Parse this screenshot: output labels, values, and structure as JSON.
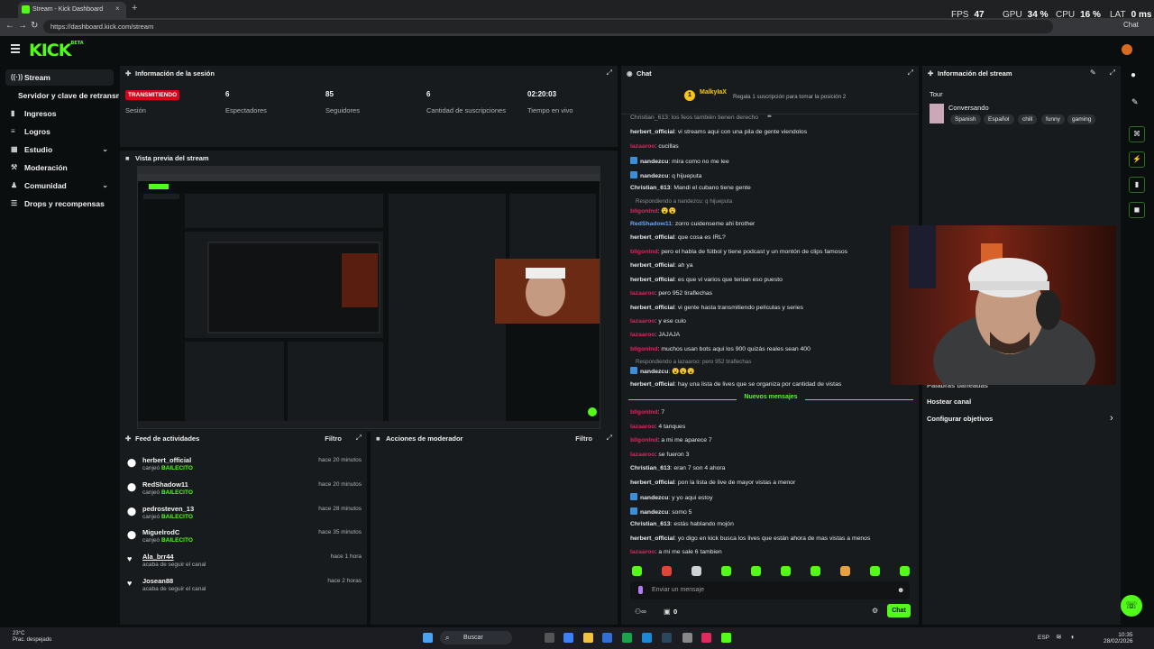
{
  "browser": {
    "tab_title": "Stream - Kick Dashboard",
    "tab_close": "×",
    "new_tab": "+",
    "url": "https://dashboard.kick.com/stream",
    "chat_pill": "Chat",
    "perf": [
      {
        "label": "FPS",
        "value": "47"
      },
      {
        "label": "GPU",
        "value": "34 %"
      },
      {
        "label": "CPU",
        "value": "16 %"
      },
      {
        "label": "LAT",
        "value": "0 ms"
      }
    ]
  },
  "app": {
    "logo": "KICK",
    "logo_sup": "BETA"
  },
  "sidebar": {
    "items": [
      {
        "icon": "((·))",
        "label": "Stream",
        "active": true
      },
      {
        "icon": "",
        "label": "Servidor y clave de retransmisión"
      },
      {
        "icon": "▮",
        "label": "Ingresos"
      },
      {
        "icon": "≡",
        "label": "Logros"
      },
      {
        "icon": "▦",
        "label": "Estudio",
        "chevron": "⌄"
      },
      {
        "icon": "⚒",
        "label": "Moderación"
      },
      {
        "icon": "♟",
        "label": "Comunidad",
        "chevron": "⌄"
      },
      {
        "icon": "☰",
        "label": "Drops y recompensas"
      }
    ]
  },
  "session": {
    "title": "Información de la sesión",
    "live_badge": "TRANSMITIENDO",
    "session_label": "Sesión",
    "stats": [
      {
        "value": "6",
        "label": "Espectadores"
      },
      {
        "value": "85",
        "label": "Seguidores"
      },
      {
        "value": "6",
        "label": "Cantidad de suscripciones"
      },
      {
        "value": "02:20:03",
        "label": "Tiempo en vivo"
      }
    ]
  },
  "preview": {
    "title": "Vista previa del stream"
  },
  "activity": {
    "title": "Feed de actividades",
    "filter": "Filtro",
    "items": [
      {
        "name": "herbert_official",
        "sub": "canjeó ",
        "reward": "BAILECITO",
        "time": "hace 20 minutos",
        "icon": "⬤"
      },
      {
        "name": "RedShadow11",
        "sub": "canjeó ",
        "reward": "BAILECITO",
        "time": "hace 20 minutos",
        "icon": "⬤"
      },
      {
        "name": "pedrosteven_13",
        "sub": "canjeó ",
        "reward": "BAILECITO",
        "time": "hace 28 minutos",
        "icon": "⬤"
      },
      {
        "name": "MiguelrodC",
        "sub": "canjeó ",
        "reward": "BAILECITO",
        "time": "hace 35 minutos",
        "icon": "⬤"
      },
      {
        "name": "Ala_brr44",
        "sub": "acaba de seguir el canal",
        "reward": "",
        "time": "hace 1 hora",
        "icon": "♥"
      },
      {
        "name": "Josean88",
        "sub": "acaba de seguir el canal",
        "reward": "",
        "time": "hace 2 horas",
        "icon": "♥"
      }
    ]
  },
  "mod_actions": {
    "title": "Acciones de moderador",
    "filter": "Filtro"
  },
  "chat": {
    "title": "Chat",
    "top_user": "MalkyIaX",
    "top_rank": "1",
    "gift_text": "Regala 1 suscripción para tomar la posición 2",
    "first_line": "Christian_613: los feos también tienen derecho",
    "new_messages": "Nuevos mensajes",
    "input_placeholder": "Enviar un mensaje",
    "send": "Chat",
    "points": "0",
    "messages": [
      {
        "user": "herbert_official",
        "color": "#e6e8ea",
        "text": "vi streams aqui con una pila de gente viendolos",
        "badge": false
      },
      {
        "user": "lazaaroo",
        "color": "#e0245e",
        "text": "cucillas",
        "badge": false
      },
      {
        "user": "nandezcu",
        "color": "#e6e8ea",
        "text": "mira como no me lee",
        "badge": true
      },
      {
        "user": "nandezcu",
        "color": "#e6e8ea",
        "text": "q hijueputa",
        "badge": true
      },
      {
        "user": "Christian_613",
        "color": "#e6e8ea",
        "text": "Mandi el cubano tiene gente",
        "badge": false
      },
      {
        "user": "bllgonlnd",
        "color": "#e0245e",
        "text": "😮😮",
        "badge": false
      },
      {
        "user": "RedShadow11",
        "color": "#69a5ff",
        "text": "zorro cuidensemе ahi brother",
        "badge": false
      },
      {
        "user": "herbert_official",
        "color": "#e6e8ea",
        "text": "que cosa es IRL?",
        "badge": false
      },
      {
        "user": "bllgonlnd",
        "color": "#e0245e",
        "text": "pero el habla de fútbol y tiene podcast y un montón de clips famosos",
        "badge": false
      },
      {
        "user": "herbert_official",
        "color": "#e6e8ea",
        "text": "ah ya",
        "badge": false
      },
      {
        "user": "herbert_official",
        "color": "#e6e8ea",
        "text": "es que vi varios que tenian eso puesto",
        "badge": false
      },
      {
        "user": "lazaaroo",
        "color": "#e0245e",
        "text": "pero 952 tiraflechas",
        "badge": false
      },
      {
        "user": "herbert_official",
        "color": "#e6e8ea",
        "text": "vi gente hasta transmitiendo películas y series",
        "badge": false
      },
      {
        "user": "lazaaroo",
        "color": "#e0245e",
        "text": "y ese culo",
        "badge": false
      },
      {
        "user": "lazaaroo",
        "color": "#e0245e",
        "text": "JAJAJA",
        "badge": false
      },
      {
        "user": "bllgonlnd",
        "color": "#e0245e",
        "text": "muchos usan bots aqui los 900 quizás reales sean 400",
        "badge": false
      },
      {
        "user": "nandezcu",
        "color": "#e6e8ea",
        "text": "😮😮😮",
        "badge": true
      },
      {
        "user": "herbert_official",
        "color": "#e6e8ea",
        "text": "hay una lista de lives que se organiza por cantidad de vistas",
        "badge": false
      },
      {
        "user": "bllgonlnd",
        "color": "#e0245e",
        "text": "7",
        "badge": false
      },
      {
        "user": "lazaaroo",
        "color": "#e0245e",
        "text": "4 tanques",
        "badge": false
      },
      {
        "user": "bllgonlnd",
        "color": "#e0245e",
        "text": "a mi me aparece 7",
        "badge": false
      },
      {
        "user": "lazaaroo",
        "color": "#e0245e",
        "text": "se fueron 3",
        "badge": false
      },
      {
        "user": "Christian_613",
        "color": "#e6e8ea",
        "text": "eran 7 son 4 ahora",
        "badge": false
      },
      {
        "user": "herbert_official",
        "color": "#e6e8ea",
        "text": "pon la lista de live de mayor vistas a menor",
        "badge": false
      },
      {
        "user": "nandezcu",
        "color": "#e6e8ea",
        "text": "y yo aqui estoy",
        "badge": true
      },
      {
        "user": "nandezcu",
        "color": "#e6e8ea",
        "text": "somo 5",
        "badge": true
      },
      {
        "user": "Christian_613",
        "color": "#e6e8ea",
        "text": "estás hablando mojón",
        "badge": false
      },
      {
        "user": "herbert_official",
        "color": "#e6e8ea",
        "text": "yo digo en kick busca los lives que están ahora de mas vistas a menos",
        "badge": false
      },
      {
        "user": "lazaaroo",
        "color": "#e0245e",
        "text": "a mi me sale 6 tambien",
        "badge": false
      }
    ],
    "replies": [
      "Respondiendo a nandezcu: q hijueputa",
      "Respondiendo a lazaaroo: pero 952 tiraflechas"
    ]
  },
  "stream_info": {
    "title": "Información del stream",
    "category": "Tour",
    "subcategory": "Conversando",
    "tags": [
      "Spanish",
      "Español",
      "chill",
      "funny",
      "gaming"
    ],
    "links": [
      "Palabras baneadas",
      "Hostear canal",
      "Configurar objetivos"
    ],
    "chevron": "›"
  },
  "colors": {
    "accent": "#53fc18",
    "panel": "#181b1d",
    "background": "#0b0e0f",
    "live_red": "#d9001b"
  },
  "taskbar": {
    "weather_temp": "23°C",
    "weather_desc": "Prac. despejado",
    "search": "Buscar",
    "lang": "ESP",
    "time": "10:35",
    "date": "28/02/2026"
  }
}
